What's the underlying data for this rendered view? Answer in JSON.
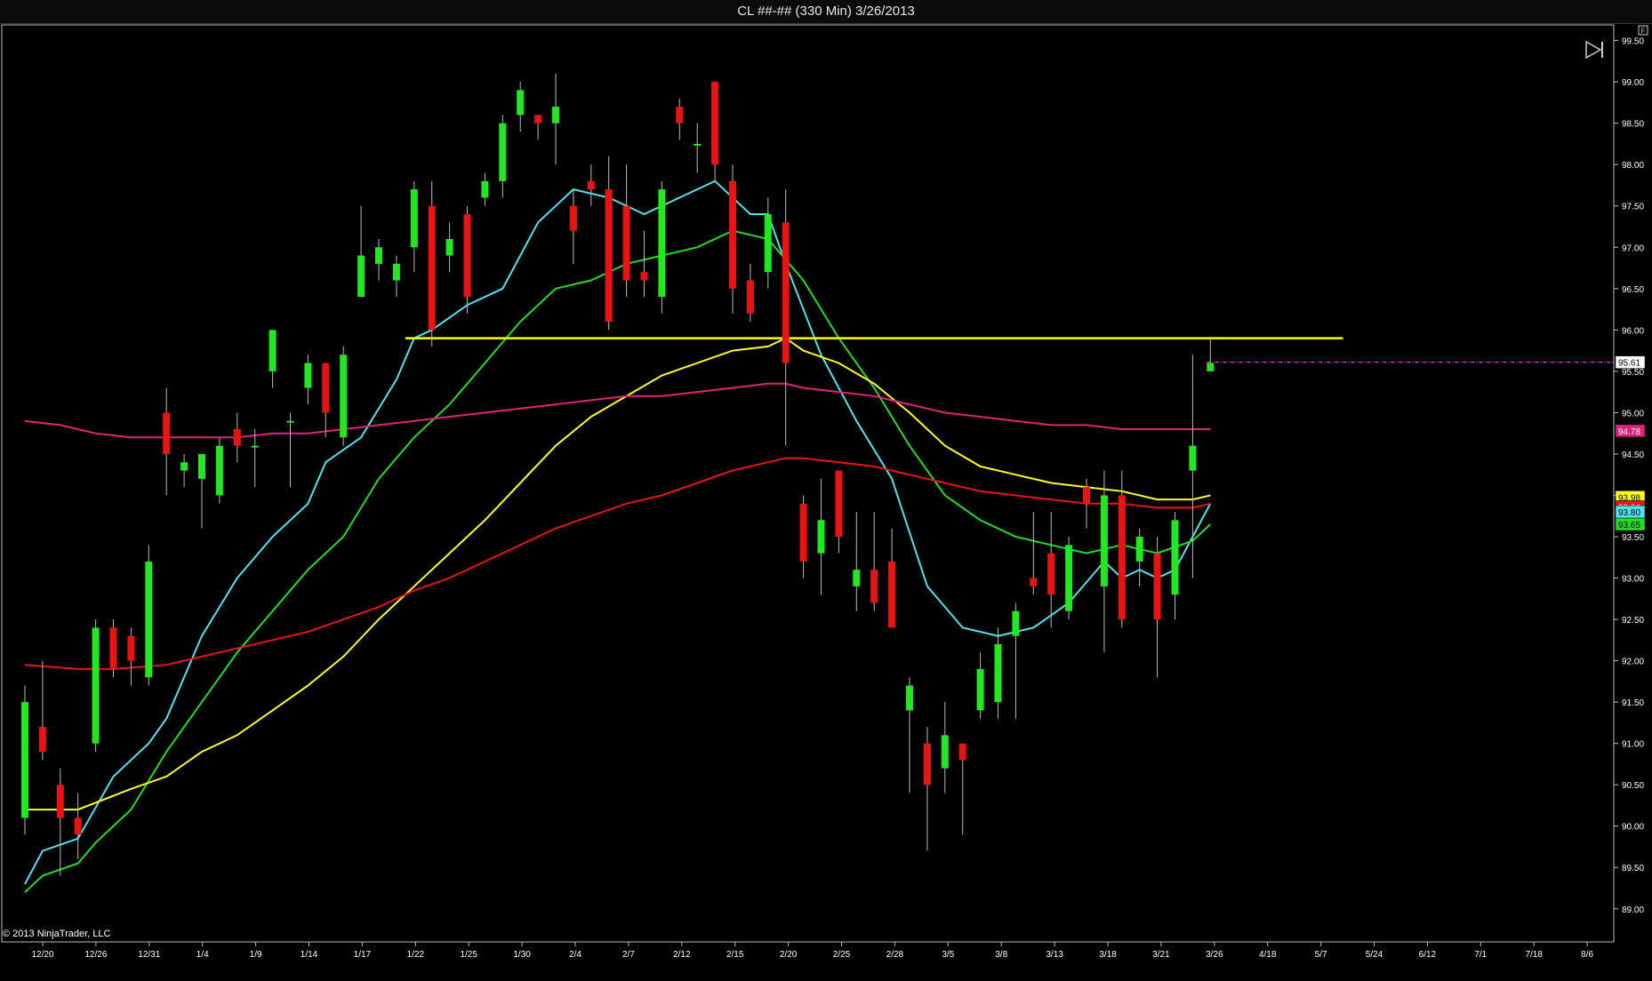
{
  "window": {
    "title": "CL ##-## (330 Min)  3/26/2013"
  },
  "copyright": "© 2013 NinjaTrader, LLC",
  "chart_data": {
    "type": "candlestick",
    "title": "CL ##-## (330 Min)  3/26/2013",
    "ylim": [
      88.6,
      99.7
    ],
    "y_ticks": [
      "99.50",
      "99.00",
      "98.50",
      "98.00",
      "97.50",
      "97.00",
      "96.50",
      "96.00",
      "95.50",
      "95.00",
      "94.50",
      "94.00",
      "93.50",
      "93.00",
      "92.50",
      "92.00",
      "91.50",
      "91.00",
      "90.50",
      "90.00",
      "89.50",
      "89.00"
    ],
    "x_ticks": [
      "12/20",
      "12/26",
      "12/31",
      "1/4",
      "1/9",
      "1/14",
      "1/17",
      "1/22",
      "1/25",
      "1/30",
      "2/4",
      "2/7",
      "2/12",
      "2/15",
      "2/20",
      "2/25",
      "2/28",
      "3/5",
      "3/8",
      "3/13",
      "3/18",
      "3/21",
      "3/26",
      "4/18",
      "5/7",
      "5/24",
      "6/12",
      "7/1",
      "7/18",
      "8/6"
    ],
    "candles": [
      [
        90.1,
        91.5,
        89.9,
        91.7
      ],
      [
        91.2,
        90.9,
        90.8,
        92.0
      ],
      [
        90.5,
        90.1,
        89.4,
        90.7
      ],
      [
        90.1,
        89.9,
        89.6,
        90.4
      ],
      [
        91.0,
        92.4,
        90.9,
        92.5
      ],
      [
        92.4,
        91.9,
        91.8,
        92.5
      ],
      [
        92.3,
        92.0,
        91.7,
        92.4
      ],
      [
        91.8,
        93.2,
        91.7,
        93.4
      ],
      [
        95.0,
        94.5,
        94.0,
        95.3
      ],
      [
        94.3,
        94.4,
        94.1,
        94.5
      ],
      [
        94.2,
        94.5,
        93.6,
        94.5
      ],
      [
        94.0,
        94.6,
        93.9,
        94.7
      ],
      [
        94.8,
        94.6,
        94.4,
        95.0
      ],
      [
        94.6,
        94.6,
        94.1,
        94.8
      ],
      [
        95.5,
        96.0,
        95.3,
        96.0
      ],
      [
        94.9,
        94.9,
        94.1,
        95.0
      ],
      [
        95.3,
        95.6,
        95.1,
        95.7
      ],
      [
        95.6,
        95.0,
        94.7,
        95.6
      ],
      [
        94.7,
        95.7,
        94.6,
        95.8
      ],
      [
        96.4,
        96.9,
        96.4,
        97.5
      ],
      [
        96.8,
        97.0,
        96.6,
        97.1
      ],
      [
        96.6,
        96.8,
        96.4,
        96.9
      ],
      [
        97.0,
        97.7,
        96.7,
        97.8
      ],
      [
        97.5,
        96.0,
        95.8,
        97.8
      ],
      [
        96.9,
        97.1,
        96.7,
        97.3
      ],
      [
        97.4,
        96.4,
        96.2,
        97.5
      ],
      [
        97.6,
        97.8,
        97.5,
        97.9
      ],
      [
        97.8,
        98.5,
        97.6,
        98.6
      ],
      [
        98.6,
        98.9,
        98.4,
        99.0
      ],
      [
        98.6,
        98.5,
        98.3,
        98.6
      ],
      [
        98.5,
        98.7,
        98.0,
        99.1
      ],
      [
        97.5,
        97.2,
        96.8,
        97.7
      ],
      [
        97.8,
        97.7,
        97.5,
        98.0
      ],
      [
        97.7,
        96.1,
        96.0,
        98.1
      ],
      [
        97.5,
        96.6,
        96.4,
        98.0
      ],
      [
        96.7,
        96.6,
        96.4,
        97.2
      ],
      [
        96.4,
        97.7,
        96.2,
        97.8
      ],
      [
        98.7,
        98.5,
        98.3,
        98.8
      ],
      [
        98.25,
        98.25,
        97.9,
        98.5
      ],
      [
        99.0,
        98.0,
        97.8,
        99.0
      ],
      [
        97.8,
        96.5,
        96.2,
        98.0
      ],
      [
        96.6,
        96.2,
        96.1,
        96.8
      ],
      [
        96.7,
        97.4,
        96.5,
        97.6
      ],
      [
        97.3,
        95.6,
        94.6,
        97.7
      ],
      [
        93.9,
        93.2,
        93.0,
        94.0
      ],
      [
        93.3,
        93.7,
        92.8,
        94.2
      ],
      [
        94.3,
        93.5,
        93.3,
        94.3
      ],
      [
        92.9,
        93.1,
        92.6,
        93.8
      ],
      [
        93.1,
        92.7,
        92.6,
        93.8
      ],
      [
        93.2,
        92.4,
        92.4,
        93.6
      ],
      [
        91.4,
        91.7,
        90.4,
        91.8
      ],
      [
        91.0,
        90.5,
        89.7,
        91.2
      ],
      [
        90.7,
        91.1,
        90.4,
        91.5
      ],
      [
        91.0,
        90.8,
        89.9,
        91.0
      ],
      [
        91.4,
        91.9,
        91.3,
        92.1
      ],
      [
        91.5,
        92.2,
        91.3,
        92.4
      ],
      [
        92.3,
        92.6,
        91.3,
        92.7
      ],
      [
        93.0,
        92.9,
        92.8,
        93.8
      ],
      [
        93.3,
        92.8,
        92.4,
        93.8
      ],
      [
        92.6,
        93.4,
        92.5,
        93.5
      ],
      [
        94.1,
        93.9,
        93.6,
        94.2
      ],
      [
        92.9,
        94.0,
        92.1,
        94.3
      ],
      [
        94.0,
        92.5,
        92.4,
        94.3
      ],
      [
        93.2,
        93.5,
        92.9,
        93.6
      ],
      [
        93.3,
        92.5,
        91.8,
        93.5
      ],
      [
        92.8,
        93.7,
        92.5,
        93.8
      ],
      [
        94.3,
        94.6,
        93.0,
        95.7
      ],
      [
        95.5,
        95.6,
        95.5,
        95.9
      ]
    ],
    "lines": [
      {
        "color": "#4fe3ee",
        "values": [
          [
            0,
            89.3
          ],
          [
            1,
            89.7
          ],
          [
            3,
            89.85
          ],
          [
            5,
            90.6
          ],
          [
            7,
            91.0
          ],
          [
            8,
            91.3
          ],
          [
            10,
            92.3
          ],
          [
            12,
            93.0
          ],
          [
            14,
            93.5
          ],
          [
            16,
            93.9
          ],
          [
            17,
            94.4
          ],
          [
            19,
            94.7
          ],
          [
            21,
            95.4
          ],
          [
            22,
            95.9
          ],
          [
            23,
            96.0
          ],
          [
            25,
            96.3
          ],
          [
            27,
            96.5
          ],
          [
            28,
            96.9
          ],
          [
            29,
            97.3
          ],
          [
            31,
            97.7
          ],
          [
            33,
            97.6
          ],
          [
            35,
            97.4
          ],
          [
            37,
            97.6
          ],
          [
            39,
            97.8
          ],
          [
            41,
            97.4
          ],
          [
            42,
            97.4
          ],
          [
            43,
            96.8
          ],
          [
            45,
            95.7
          ],
          [
            47,
            94.9
          ],
          [
            49,
            94.2
          ],
          [
            51,
            92.9
          ],
          [
            53,
            92.4
          ],
          [
            55,
            92.3
          ],
          [
            57,
            92.4
          ],
          [
            59,
            92.7
          ],
          [
            61,
            93.2
          ],
          [
            62,
            93.0
          ],
          [
            63,
            93.1
          ],
          [
            64,
            93.0
          ],
          [
            65,
            93.1
          ],
          [
            66,
            93.5
          ],
          [
            67,
            93.9
          ]
        ]
      },
      {
        "color": "#22dd22",
        "values": [
          [
            0,
            89.2
          ],
          [
            1,
            89.4
          ],
          [
            3,
            89.55
          ],
          [
            4,
            89.8
          ],
          [
            6,
            90.2
          ],
          [
            8,
            90.9
          ],
          [
            10,
            91.5
          ],
          [
            12,
            92.1
          ],
          [
            14,
            92.6
          ],
          [
            16,
            93.1
          ],
          [
            18,
            93.5
          ],
          [
            20,
            94.2
          ],
          [
            22,
            94.7
          ],
          [
            24,
            95.1
          ],
          [
            26,
            95.6
          ],
          [
            28,
            96.1
          ],
          [
            30,
            96.5
          ],
          [
            32,
            96.6
          ],
          [
            34,
            96.8
          ],
          [
            36,
            96.9
          ],
          [
            38,
            97.0
          ],
          [
            40,
            97.2
          ],
          [
            42,
            97.1
          ],
          [
            44,
            96.6
          ],
          [
            46,
            95.9
          ],
          [
            48,
            95.3
          ],
          [
            50,
            94.6
          ],
          [
            52,
            94.0
          ],
          [
            54,
            93.7
          ],
          [
            56,
            93.5
          ],
          [
            58,
            93.4
          ],
          [
            60,
            93.3
          ],
          [
            62,
            93.4
          ],
          [
            64,
            93.3
          ],
          [
            66,
            93.45
          ],
          [
            67,
            93.65
          ]
        ]
      },
      {
        "color": "#ffff22",
        "values": [
          [
            0,
            90.2
          ],
          [
            3,
            90.2
          ],
          [
            6,
            90.45
          ],
          [
            8,
            90.6
          ],
          [
            10,
            90.9
          ],
          [
            12,
            91.1
          ],
          [
            14,
            91.4
          ],
          [
            16,
            91.7
          ],
          [
            18,
            92.05
          ],
          [
            20,
            92.5
          ],
          [
            22,
            92.9
          ],
          [
            24,
            93.3
          ],
          [
            26,
            93.7
          ],
          [
            28,
            94.15
          ],
          [
            30,
            94.6
          ],
          [
            32,
            94.95
          ],
          [
            34,
            95.2
          ],
          [
            36,
            95.45
          ],
          [
            38,
            95.6
          ],
          [
            40,
            95.75
          ],
          [
            42,
            95.8
          ],
          [
            43,
            95.9
          ],
          [
            44,
            95.75
          ],
          [
            46,
            95.6
          ],
          [
            48,
            95.35
          ],
          [
            50,
            95.0
          ],
          [
            52,
            94.6
          ],
          [
            54,
            94.35
          ],
          [
            56,
            94.25
          ],
          [
            58,
            94.15
          ],
          [
            60,
            94.1
          ],
          [
            62,
            94.05
          ],
          [
            64,
            93.95
          ],
          [
            66,
            93.95
          ],
          [
            67,
            94.0
          ]
        ]
      },
      {
        "color": "#e81414",
        "values": [
          [
            0,
            91.95
          ],
          [
            3,
            91.9
          ],
          [
            5,
            91.9
          ],
          [
            8,
            91.95
          ],
          [
            10,
            92.05
          ],
          [
            12,
            92.15
          ],
          [
            14,
            92.25
          ],
          [
            16,
            92.35
          ],
          [
            18,
            92.5
          ],
          [
            20,
            92.65
          ],
          [
            22,
            92.85
          ],
          [
            24,
            93.0
          ],
          [
            26,
            93.2
          ],
          [
            28,
            93.4
          ],
          [
            30,
            93.6
          ],
          [
            32,
            93.75
          ],
          [
            34,
            93.9
          ],
          [
            36,
            94.0
          ],
          [
            38,
            94.15
          ],
          [
            40,
            94.3
          ],
          [
            42,
            94.4
          ],
          [
            43,
            94.45
          ],
          [
            44,
            94.45
          ],
          [
            46,
            94.4
          ],
          [
            48,
            94.35
          ],
          [
            50,
            94.25
          ],
          [
            52,
            94.15
          ],
          [
            54,
            94.05
          ],
          [
            56,
            94.0
          ],
          [
            58,
            93.95
          ],
          [
            60,
            93.9
          ],
          [
            62,
            93.9
          ],
          [
            64,
            93.85
          ],
          [
            66,
            93.85
          ],
          [
            67,
            93.9
          ]
        ]
      },
      {
        "color": "#e0237a",
        "values": [
          [
            0,
            94.9
          ],
          [
            2,
            94.85
          ],
          [
            4,
            94.75
          ],
          [
            6,
            94.7
          ],
          [
            8,
            94.7
          ],
          [
            10,
            94.7
          ],
          [
            12,
            94.7
          ],
          [
            14,
            94.75
          ],
          [
            16,
            94.75
          ],
          [
            18,
            94.8
          ],
          [
            20,
            94.85
          ],
          [
            22,
            94.9
          ],
          [
            24,
            94.95
          ],
          [
            26,
            95.0
          ],
          [
            28,
            95.05
          ],
          [
            30,
            95.1
          ],
          [
            32,
            95.15
          ],
          [
            34,
            95.2
          ],
          [
            36,
            95.2
          ],
          [
            38,
            95.25
          ],
          [
            40,
            95.3
          ],
          [
            42,
            95.35
          ],
          [
            43,
            95.35
          ],
          [
            44,
            95.3
          ],
          [
            46,
            95.25
          ],
          [
            48,
            95.2
          ],
          [
            50,
            95.1
          ],
          [
            52,
            95.0
          ],
          [
            54,
            94.95
          ],
          [
            56,
            94.9
          ],
          [
            58,
            94.85
          ],
          [
            60,
            94.85
          ],
          [
            62,
            94.8
          ],
          [
            64,
            94.8
          ],
          [
            66,
            94.8
          ],
          [
            67,
            94.8
          ]
        ]
      }
    ],
    "hline": {
      "value": 95.9,
      "color": "#ffff00",
      "x_from": 21.5,
      "x_to": 74.5
    },
    "price_line": {
      "value": 95.61,
      "color": "#cc33cc",
      "x_from": 66.8
    },
    "price_markers": [
      {
        "label": "95.61",
        "value": 95.61,
        "bg": "#ffffff",
        "fg": "#000000"
      },
      {
        "label": "94.78",
        "value": 94.78,
        "bg": "#e0237a",
        "fg": "#ffffff"
      },
      {
        "label": "93.98",
        "value": 93.98,
        "bg": "#ffff22",
        "fg": "#000000"
      },
      {
        "label": "93.86",
        "value": 93.86,
        "bg": "#e81414",
        "fg": "#ffffff"
      },
      {
        "label": "93.80",
        "value": 93.8,
        "bg": "#4fe3ee",
        "fg": "#000000"
      },
      {
        "label": "93.65",
        "value": 93.65,
        "bg": "#22dd22",
        "fg": "#000000"
      }
    ]
  }
}
